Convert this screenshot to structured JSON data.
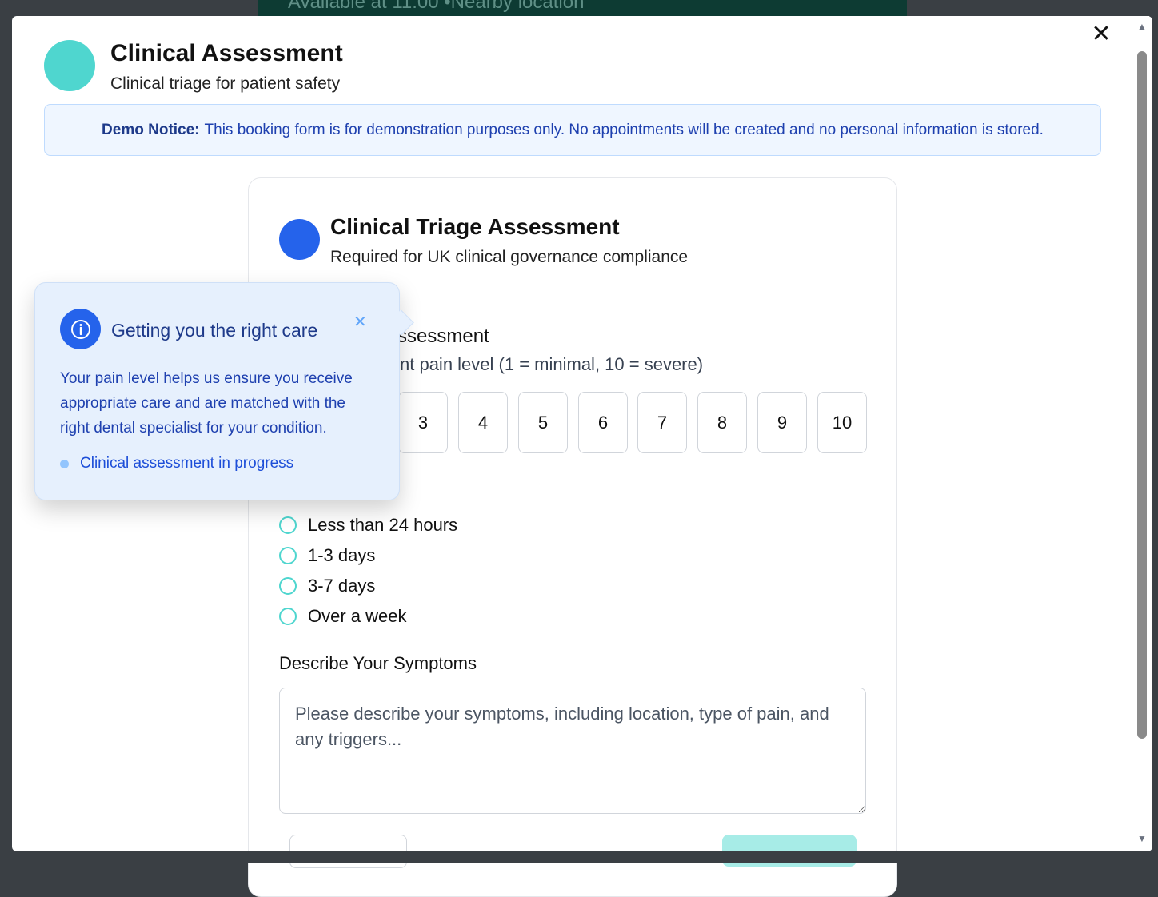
{
  "background": {
    "banner_text": "Available at 11:00 •Nearby location"
  },
  "modal": {
    "title": "Clinical Assessment",
    "subtitle": "Clinical triage for patient safety",
    "close_icon": "close-icon",
    "accent_color": "#4fd6cf"
  },
  "notice": {
    "label": "Demo Notice:",
    "text": "This booking form is for demonstration purposes only. No appointments will be created and no personal information is stored."
  },
  "card": {
    "title": "Clinical Triage Assessment",
    "subtitle": "Required for UK clinical governance compliance",
    "pain": {
      "label": "ssessment",
      "hint": "nt pain level (1 = minimal, 10 = severe)",
      "levels": [
        "3",
        "4",
        "5",
        "6",
        "7",
        "8",
        "9",
        "10"
      ]
    },
    "duration": {
      "options": [
        "Less than 24 hours",
        "1-3 days",
        "3-7 days",
        "Over a week"
      ]
    },
    "symptoms": {
      "label": "Describe Your Symptoms",
      "placeholder": "Please describe your symptoms, including location, type of pain, and any triggers..."
    }
  },
  "tooltip": {
    "title": "Getting you the right care",
    "body": "Your pain level helps us ensure you receive appropriate care and are matched with the right dental specialist for your condition.",
    "status": "Clinical assessment in progress",
    "icon": "info-icon"
  }
}
